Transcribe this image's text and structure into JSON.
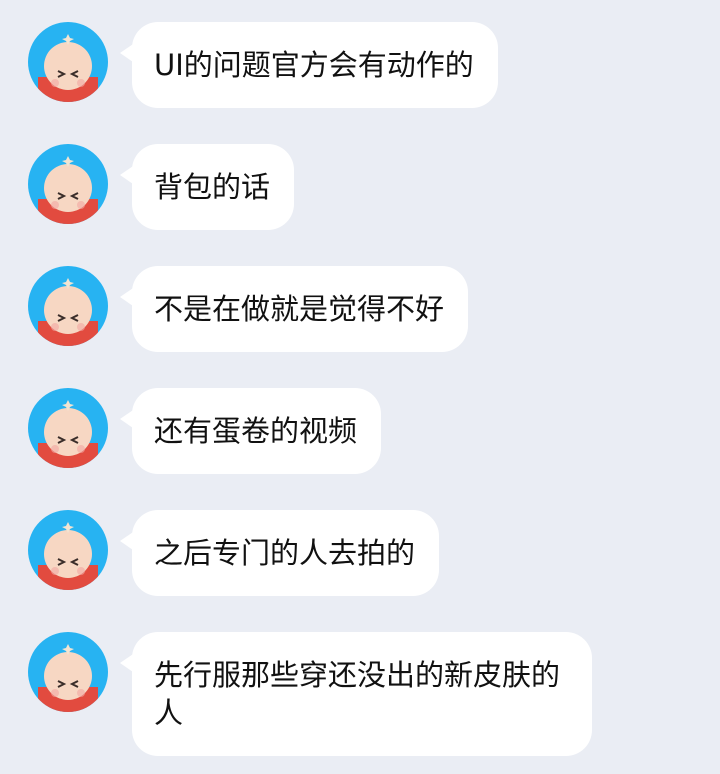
{
  "messages": [
    {
      "avatar_icon": "cartoon-face-avatar-icon",
      "text": "UI的问题官方会有动作的"
    },
    {
      "avatar_icon": "cartoon-face-avatar-icon",
      "text": "背包的话"
    },
    {
      "avatar_icon": "cartoon-face-avatar-icon",
      "text": "不是在做就是觉得不好"
    },
    {
      "avatar_icon": "cartoon-face-avatar-icon",
      "text": "还有蛋卷的视频"
    },
    {
      "avatar_icon": "cartoon-face-avatar-icon",
      "text": "之后专门的人去拍的"
    },
    {
      "avatar_icon": "cartoon-face-avatar-icon",
      "text": "先行服那些穿还没出的新皮肤的人"
    }
  ],
  "colors": {
    "background": "#eaedf4",
    "bubble": "#ffffff",
    "avatar_bg": "#27b3f2",
    "avatar_face": "#f7d7c3",
    "avatar_body": "#e24b3f"
  }
}
